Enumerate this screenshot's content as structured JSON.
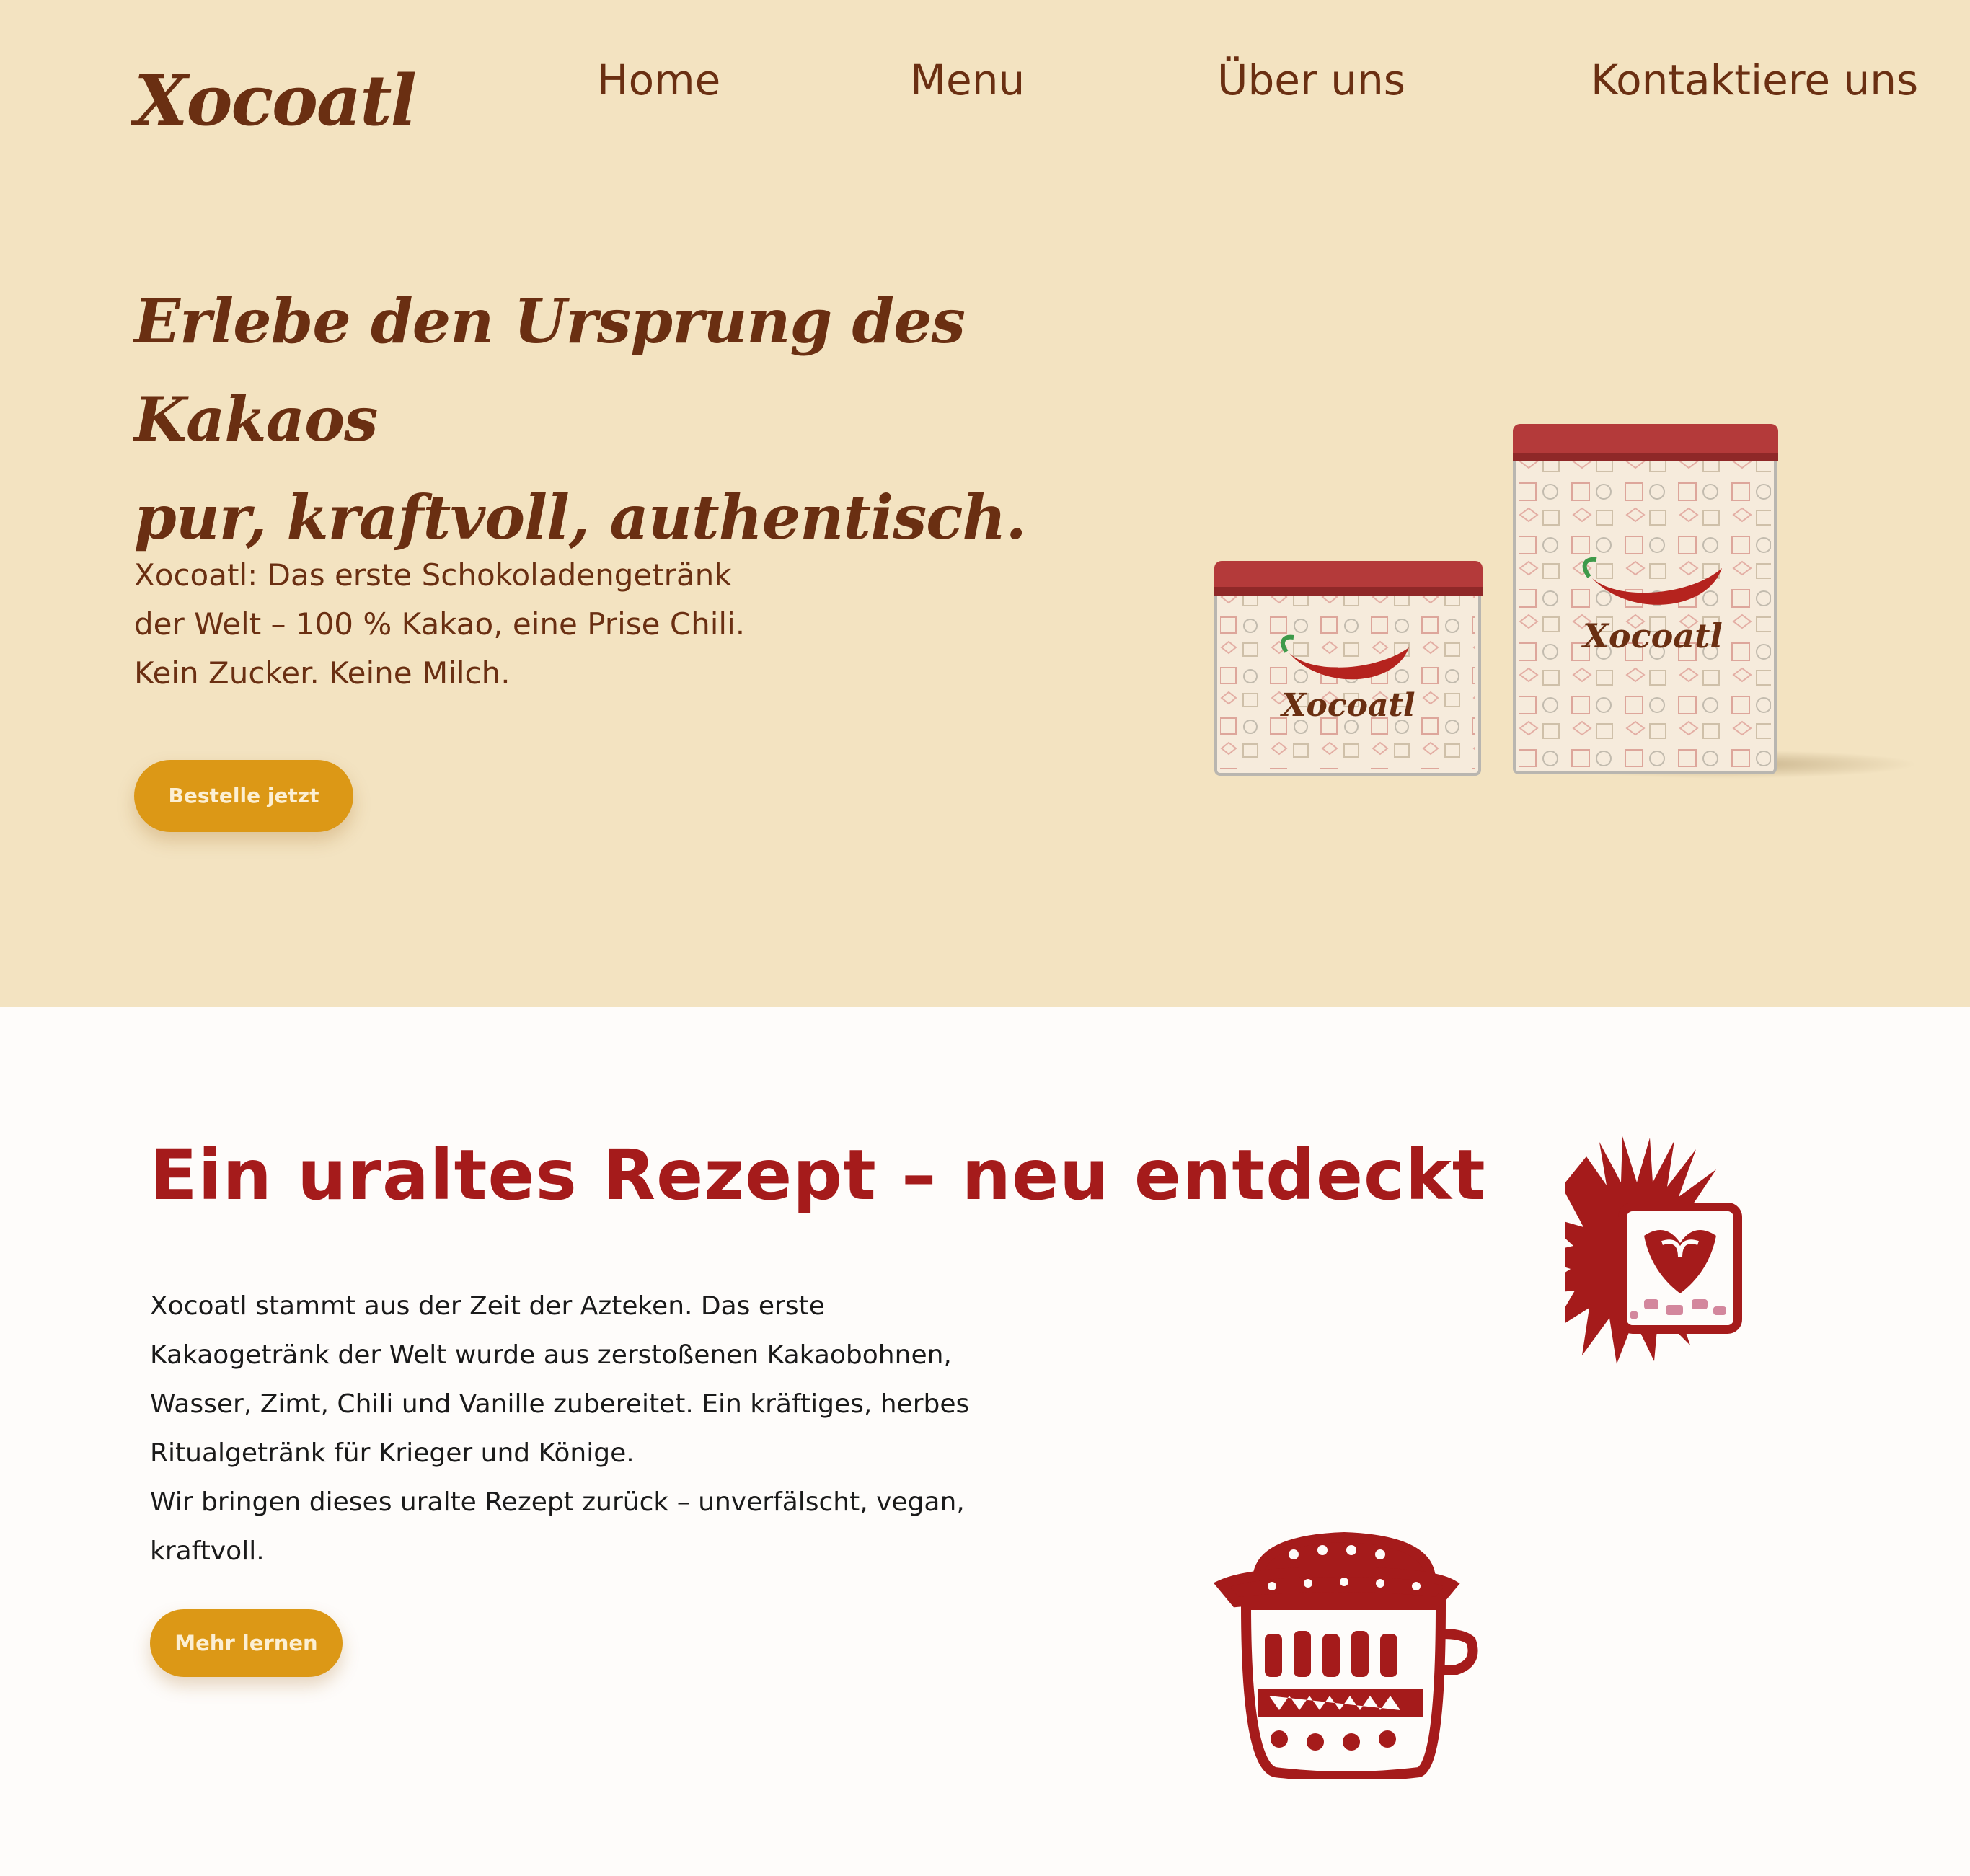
{
  "brand": {
    "logo": "Xocoatl"
  },
  "nav": {
    "items": [
      {
        "label": "Home"
      },
      {
        "label": "Menu"
      },
      {
        "label": "Über uns"
      },
      {
        "label": "Kontaktiere uns"
      }
    ]
  },
  "hero": {
    "title_line1": "Erlebe den Ursprung des Kakaos",
    "title_line2": "pur, kraftvoll, authentisch.",
    "text_line1": "Xocoatl: Das erste Schokoladengetränk",
    "text_line2": "der Welt – 100 % Kakao, eine Prise Chili.",
    "text_line3": "Kein Zucker. Keine Milch.",
    "cta_label": "Bestelle jetzt",
    "tin_label": "Xocoatl"
  },
  "about": {
    "title": "Ein uraltes Rezept – neu entdeckt",
    "lines": [
      "Xocoatl stammt aus der Zeit der Azteken. Das erste",
      "Kakaogetränk der Welt wurde aus zerstoßenen Kakaobohnen,",
      "Wasser, Zimt, Chili und Vanille zubereitet. Ein kräftiges, herbes",
      "Ritualgetränk für Krieger und Könige.",
      "Wir bringen dieses uralte Rezept zurück – unverfälscht, vegan,",
      "kraftvoll."
    ],
    "cta_label": "Mehr lernen"
  },
  "colors": {
    "hero_bg": "#f3e3c1",
    "brown": "#6a2f12",
    "red": "#a51b1b",
    "gold": "#dc9816",
    "page_bg": "#fefcfa"
  }
}
